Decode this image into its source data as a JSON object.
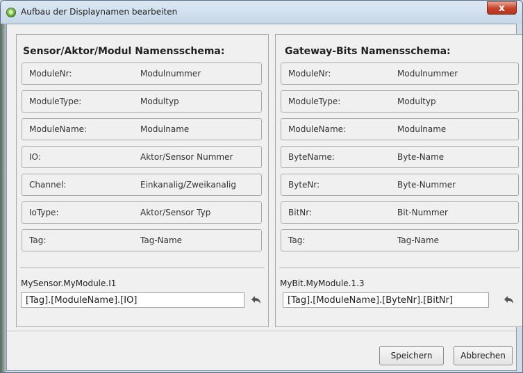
{
  "window": {
    "title": "Aufbau der Displaynamen bearbeiten",
    "close_label": "x"
  },
  "left_panel": {
    "heading": "Sensor/Aktor/Modul Namensschema:",
    "rows": [
      {
        "key": "ModuleNr:",
        "value": "Modulnummer"
      },
      {
        "key": "ModuleType:",
        "value": "Modultyp"
      },
      {
        "key": "ModuleName:",
        "value": "Modulname"
      },
      {
        "key": "IO:",
        "value": "Aktor/Sensor Nummer"
      },
      {
        "key": "Channel:",
        "value": "Einkanalig/Zweikanalig"
      },
      {
        "key": "IoType:",
        "value": "Aktor/Sensor Typ"
      },
      {
        "key": "Tag:",
        "value": "Tag-Name"
      }
    ],
    "preview": "MySensor.MyModule.I1",
    "pattern": "[Tag].[ModuleName].[IO]"
  },
  "right_panel": {
    "heading": "Gateway-Bits Namensschema:",
    "rows": [
      {
        "key": "ModuleNr:",
        "value": "Modulnummer"
      },
      {
        "key": "ModuleType:",
        "value": "Modultyp"
      },
      {
        "key": "ModuleName:",
        "value": "Modulname"
      },
      {
        "key": "ByteName:",
        "value": "Byte-Name"
      },
      {
        "key": "ByteNr:",
        "value": "Byte-Nummer"
      },
      {
        "key": "BitNr:",
        "value": "Bit-Nummer"
      },
      {
        "key": "Tag:",
        "value": "Tag-Name"
      }
    ],
    "preview": "MyBit.MyModule.1.3",
    "pattern": "[Tag].[ModuleName].[ByteNr].[BitNr]"
  },
  "buttons": {
    "save": "Speichern",
    "cancel": "Abbrechen"
  },
  "icons": {
    "app": "app-logo-icon",
    "undo": "undo-icon"
  }
}
